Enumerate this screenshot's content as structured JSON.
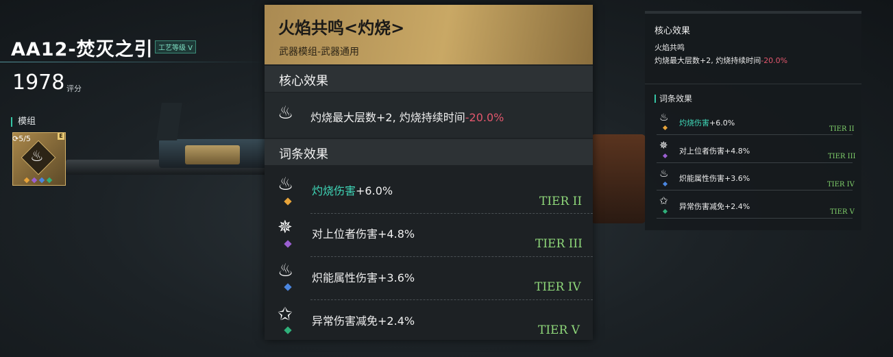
{
  "weapon": {
    "name": "AA12-焚灭之引",
    "craft_badge": "工艺等级 V",
    "score": "1978",
    "score_label": "评分",
    "module_label": "模组",
    "module_count": "5/5",
    "module_slot_badge": "E"
  },
  "tooltip": {
    "title": "火焰共鸣<灼烧>",
    "subtitle": "武器模组-武器通用",
    "core_section_title": "核心效果",
    "core_effect_text": "灼烧最大层数+2, 灼烧持续时间",
    "core_effect_value": "-20.0%",
    "affix_section_title": "词条效果",
    "affixes": [
      {
        "name": "灼烧伤害",
        "value": "+6.0%",
        "tier": "TIER II",
        "highlight": true,
        "gem_color": "#e8a43a",
        "icon": "flame-burst-icon"
      },
      {
        "name": "对上位者伤害",
        "value": "+4.8%",
        "tier": "TIER III",
        "highlight": false,
        "gem_color": "#9a5fd1",
        "icon": "spiked-star-icon"
      },
      {
        "name": "炽能属性伤害",
        "value": "+3.6%",
        "tier": "TIER IV",
        "highlight": false,
        "gem_color": "#4b86e0",
        "icon": "flame-star-icon"
      },
      {
        "name": "异常伤害减免",
        "value": "+2.4%",
        "tier": "TIER V",
        "highlight": false,
        "gem_color": "#2fb07a",
        "icon": "star-shield-icon"
      }
    ]
  },
  "compact": {
    "core_title": "核心效果",
    "core_name": "火焰共鸣",
    "core_text": "灼烧最大层数+2, 灼烧持续时间",
    "core_value": "-20.0%",
    "affix_title": "词条效果",
    "affixes": [
      {
        "name": "灼烧伤害",
        "value": "+6.0%",
        "tier": "TIER II"
      },
      {
        "name": "对上位者伤害",
        "value": "+4.8%",
        "tier": "TIER III"
      },
      {
        "name": "炽能属性伤害",
        "value": "+3.6%",
        "tier": "TIER IV"
      },
      {
        "name": "异常伤害减免",
        "value": "+2.4%",
        "tier": "TIER V"
      }
    ]
  },
  "colors": {
    "accent_teal": "#3fd6b7",
    "negative": "#e2576d",
    "gold": "#c9a865",
    "tier_green": "#8fd87a"
  }
}
